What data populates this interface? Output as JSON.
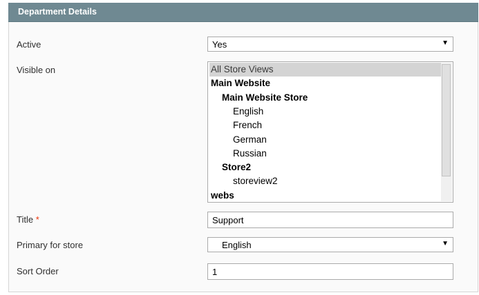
{
  "section": {
    "title": "Department Details"
  },
  "fields": {
    "active": {
      "label": "Active",
      "value": "Yes"
    },
    "visible_on": {
      "label": "Visible on",
      "options": [
        {
          "text": "All Store Views",
          "type": "option",
          "selected": true,
          "indent": 0
        },
        {
          "text": "Main Website",
          "type": "group",
          "selected": false,
          "indent": 0
        },
        {
          "text": "Main Website Store",
          "type": "group",
          "selected": false,
          "indent": 1
        },
        {
          "text": "English",
          "type": "option",
          "selected": false,
          "indent": 2
        },
        {
          "text": "French",
          "type": "option",
          "selected": false,
          "indent": 2
        },
        {
          "text": "German",
          "type": "option",
          "selected": false,
          "indent": 2
        },
        {
          "text": "Russian",
          "type": "option",
          "selected": false,
          "indent": 2
        },
        {
          "text": "Store2",
          "type": "group",
          "selected": false,
          "indent": 1
        },
        {
          "text": "storeview2",
          "type": "option",
          "selected": false,
          "indent": 2
        },
        {
          "text": "webs",
          "type": "group",
          "selected": false,
          "indent": 0
        }
      ]
    },
    "title": {
      "label": "Title",
      "required_mark": "*",
      "value": "Support"
    },
    "primary_store": {
      "label": "Primary for store",
      "value": "English"
    },
    "sort_order": {
      "label": "Sort Order",
      "value": "1"
    }
  },
  "icons": {
    "dropdown": "chevron-down-icon"
  }
}
